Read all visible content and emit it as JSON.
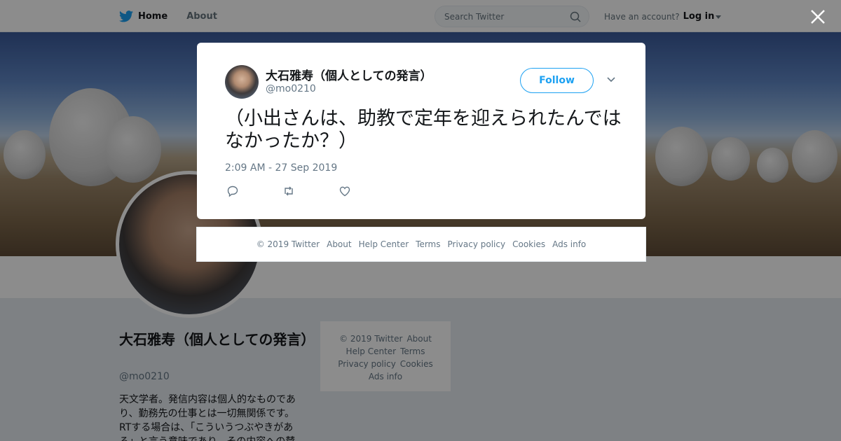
{
  "nav": {
    "home_label": "Home",
    "about_label": "About",
    "search_placeholder": "Search Twitter",
    "have_account": "Have an account?",
    "login_label": "Log in"
  },
  "profile": {
    "name": "大石雅寿（個人としての発言）",
    "handle": "@mo0210",
    "bio": "天文学者。発信内容は個人的なものであり、勤務先の仕事とは一切無関係です。RTする場合は、「こういうつぶやきがある」と言う意味であり、その内容への賛"
  },
  "side_footer": {
    "copyright": "© 2019 Twitter",
    "about": "About",
    "help": "Help Center",
    "terms": "Terms",
    "privacy": "Privacy policy",
    "cookies": "Cookies",
    "ads": "Ads info"
  },
  "tweet": {
    "author_name": "大石雅寿（個人としての発言）",
    "author_handle": "@mo0210",
    "follow_label": "Follow",
    "text": "（小出さんは、助教で定年を迎えられたんではなかったか？）",
    "timestamp": "2:09 AM - 27 Sep 2019"
  },
  "modal_footer": {
    "copyright": "© 2019 Twitter",
    "about": "About",
    "help": "Help Center",
    "terms": "Terms",
    "privacy": "Privacy policy",
    "cookies": "Cookies",
    "ads": "Ads info"
  },
  "icons": {
    "brand": "twitter-bird-icon",
    "search": "search-icon",
    "close": "close-icon",
    "menu": "chevron-down-icon",
    "reply": "reply-icon",
    "retweet": "retweet-icon",
    "like": "heart-icon"
  },
  "colors": {
    "accent": "#1da1f2",
    "text": "#14171a",
    "muted": "#657786"
  }
}
